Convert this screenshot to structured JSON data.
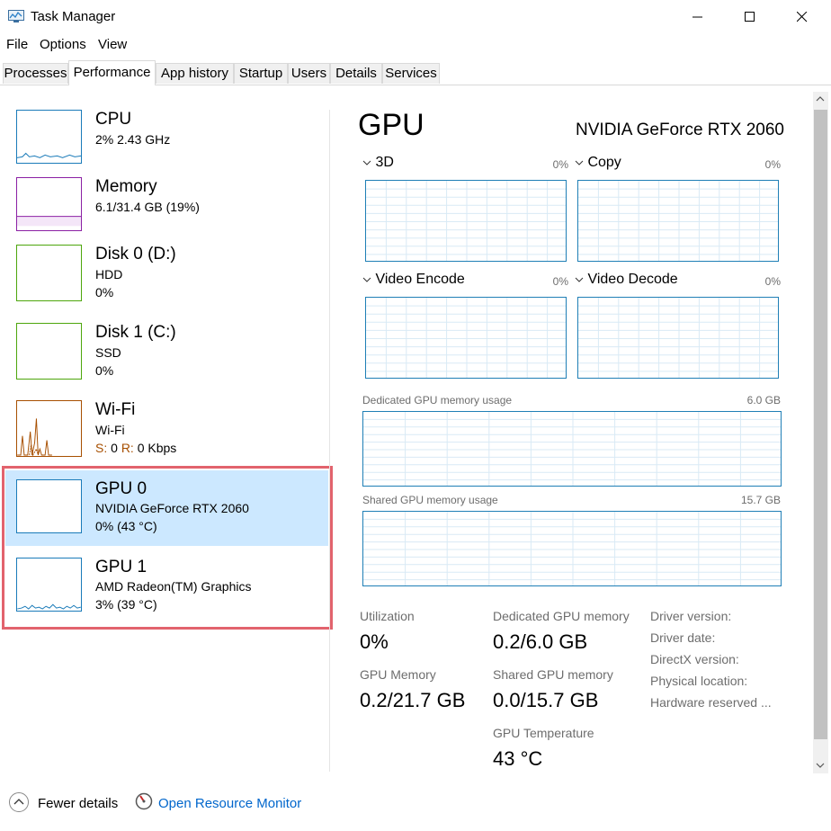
{
  "window": {
    "title": "Task Manager"
  },
  "menu": [
    "File",
    "Options",
    "View"
  ],
  "tabs": [
    "Processes",
    "Performance",
    "App history",
    "Startup",
    "Users",
    "Details",
    "Services"
  ],
  "sidebar": {
    "items": [
      {
        "name": "CPU",
        "line1": "2% 2.43 GHz",
        "line2": "",
        "color": "#1a7bb9"
      },
      {
        "name": "Memory",
        "line1": "6.1/31.4 GB (19%)",
        "line2": "",
        "color": "#8b20a4"
      },
      {
        "name": "Disk 0 (D:)",
        "line1": "HDD",
        "line2": "0%",
        "color": "#4da60c"
      },
      {
        "name": "Disk 1 (C:)",
        "line1": "SSD",
        "line2": "0%",
        "color": "#4da60c"
      },
      {
        "name": "Wi-Fi",
        "line1": "Wi-Fi",
        "line2_s_label": "S:",
        "line2_s_value": "0",
        "line2_r_label": "R:",
        "line2_r_value": "0 Kbps",
        "color": "#a74f01"
      },
      {
        "name": "GPU 0",
        "line1": "NVIDIA GeForce RTX 2060",
        "line2": "0% (43 °C)",
        "color": "#1a7bb9",
        "selected": true
      },
      {
        "name": "GPU 1",
        "line1": "AMD Radeon(TM) Graphics",
        "line2": "3% (39 °C)",
        "color": "#1a7bb9"
      }
    ]
  },
  "detail": {
    "title": "GPU",
    "device": "NVIDIA GeForce RTX 2060",
    "engines": [
      {
        "label": "3D",
        "percent": "0%"
      },
      {
        "label": "Copy",
        "percent": "0%"
      },
      {
        "label": "Video Encode",
        "percent": "0%"
      },
      {
        "label": "Video Decode",
        "percent": "0%"
      }
    ],
    "dedicated": {
      "label": "Dedicated GPU memory usage",
      "max": "6.0 GB"
    },
    "shared": {
      "label": "Shared GPU memory usage",
      "max": "15.7 GB"
    },
    "stats": {
      "utilization_label": "Utilization",
      "utilization": "0%",
      "gpu_memory_label": "GPU Memory",
      "gpu_memory": "0.2/21.7 GB",
      "dedicated_label": "Dedicated GPU memory",
      "dedicated": "0.2/6.0 GB",
      "shared_label": "Shared GPU memory",
      "shared": "0.0/15.7 GB",
      "temp_label": "GPU Temperature",
      "temp": "43 °C"
    },
    "driver": [
      "Driver version:",
      "Driver date:",
      "DirectX version:",
      "Physical location:",
      "Hardware reserved ..."
    ]
  },
  "footer": {
    "fewer_details": "Fewer details",
    "open_monitor": "Open Resource Monitor"
  },
  "colors": {
    "accent": "#1a7bb9",
    "selected_bg": "#cce8ff",
    "highlight": "#e2636d",
    "link": "#0066cc"
  }
}
